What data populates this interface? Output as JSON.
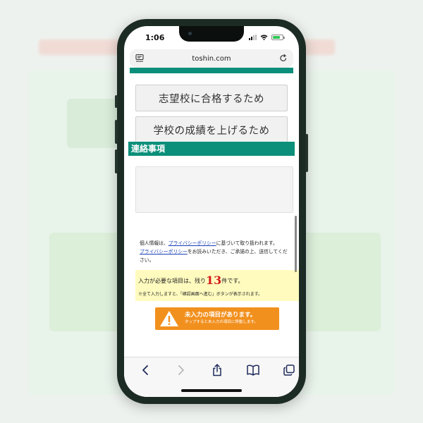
{
  "status_bar": {
    "time": "1:06",
    "battery_level": 0.75,
    "colors": {
      "battery": "#34c759"
    }
  },
  "browser": {
    "url": "toshin.com"
  },
  "form": {
    "choices": [
      {
        "label": "志望校に合格するため"
      },
      {
        "label": "学校の成績を上げるため"
      }
    ],
    "contact_section_title": "連絡事項",
    "privacy": {
      "prefix": "個人情報は、",
      "link1": "プライバシーポリシー",
      "middle": "に基づいて取り扱われます。",
      "link2": "プライバシーポリシー",
      "suffix": "をお読みいただき、ご承諾の上、送信してください。"
    },
    "required": {
      "prefix": "入力が必要な項目は、残り",
      "count": "13",
      "suffix": "件です。",
      "note": "※全て入力しますと、「確認画面へ進む」ボタンが表示されます。"
    },
    "warning_button": {
      "title": "未入力の項目があります。",
      "subtitle": "タップすると未入力の項目に移動します。"
    }
  },
  "colors": {
    "accent_green": "#0c8f7a",
    "warning_orange": "#f2901e",
    "highlight_yellow": "#fffbbf",
    "count_red": "#d31a1a",
    "link_blue": "#1a3fb8"
  },
  "toolbar": {
    "icons": [
      "back-arrow-icon",
      "forward-arrow-icon",
      "share-icon",
      "bookmarks-icon",
      "tabs-icon"
    ]
  }
}
